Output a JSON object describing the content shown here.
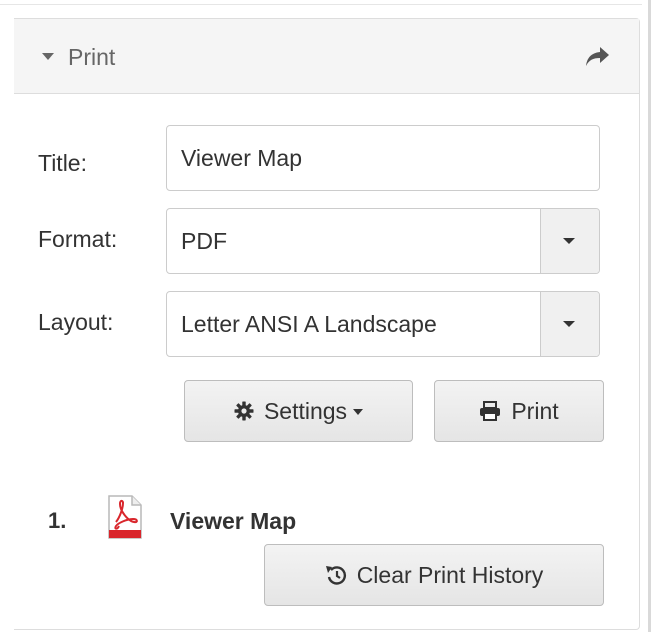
{
  "panel": {
    "title": "Print",
    "header_icon": "share-icon"
  },
  "form": {
    "title_label": "Title:",
    "title_value": "Viewer Map",
    "format_label": "Format:",
    "format_value": "PDF",
    "layout_label": "Layout:",
    "layout_value": "Letter ANSI A Landscape"
  },
  "buttons": {
    "settings_label": "Settings",
    "settings_icon": "gear-icon",
    "print_label": "Print",
    "print_icon": "printer-icon",
    "clear_history_label": "Clear Print History",
    "clear_history_icon": "history-icon"
  },
  "history": [
    {
      "index": "1.",
      "file_icon": "pdf-file-icon",
      "title": "Viewer Map"
    }
  ],
  "colors": {
    "header_background": "#f5f5f5",
    "border": "#dddddd",
    "button_background": "#e8e8e8",
    "pdf_red": "#d9262c"
  }
}
